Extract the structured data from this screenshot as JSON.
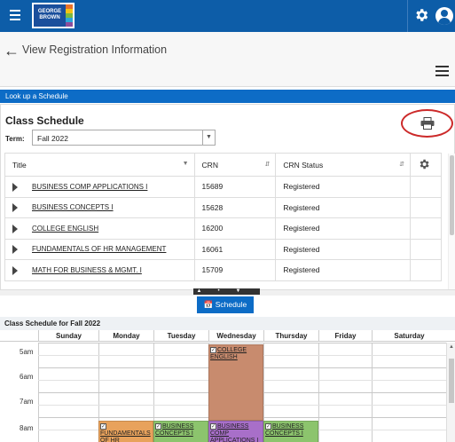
{
  "topbar": {
    "logo_text": "GEORGE BROWN",
    "logo_stripe_colors": [
      "#e9722a",
      "#f3c216",
      "#7bb841",
      "#2ba6d9",
      "#8a4d9c"
    ],
    "settings_icon": "gear-icon",
    "user_icon": "user-icon"
  },
  "header": {
    "back_icon": "arrow-left-icon",
    "title": "View Registration Information",
    "menu_icon": "hamburger-icon"
  },
  "lookup": {
    "label": "Look up a Schedule"
  },
  "class_schedule": {
    "title": "Class Schedule",
    "print_icon": "printer-icon",
    "term_label": "Term:",
    "term_value": "Fall 2022",
    "columns": [
      "Title",
      "CRN",
      "CRN Status"
    ],
    "rows": [
      {
        "title": "BUSINESS COMP APPLICATIONS I",
        "crn": "15689",
        "status": "Registered"
      },
      {
        "title": "BUSINESS CONCEPTS I",
        "crn": "15628",
        "status": "Registered"
      },
      {
        "title": "COLLEGE ENGLISH",
        "crn": "16200",
        "status": "Registered"
      },
      {
        "title": "FUNDAMENTALS OF HR MANAGEMENT",
        "crn": "16061",
        "status": "Registered"
      },
      {
        "title": "MATH FOR BUSINESS & MGMT. I",
        "crn": "15709",
        "status": "Registered"
      }
    ]
  },
  "schedule_button": {
    "label": "Schedule",
    "icon": "calendar-icon"
  },
  "calendar": {
    "title": "Class Schedule for Fall 2022",
    "days": [
      "Sunday",
      "Monday",
      "Tuesday",
      "Wednesday",
      "Thursday",
      "Friday",
      "Saturday"
    ],
    "times": [
      "5am",
      "6am",
      "7am",
      "8am"
    ],
    "events": [
      {
        "label": "COLLEGE ENGLISH",
        "day": "Wednesday",
        "color": "#c88b6e"
      },
      {
        "label": "FUNDAMENTALS OF HR MANAGEMENT",
        "day": "Monday",
        "color": "#e8a25c"
      },
      {
        "label": "BUSINESS CONCEPTS I",
        "day": "Tuesday",
        "color": "#8cc46d"
      },
      {
        "label": "BUSINESS COMP APPLICATIONS I",
        "day": "Wednesday",
        "color": "#a86fc9"
      },
      {
        "label": "BUSINESS CONCEPTS I",
        "day": "Thursday",
        "color": "#8cc46d"
      }
    ]
  },
  "colors": {
    "brand_blue": "#0d5da8",
    "accent_blue": "#0d6cc6",
    "highlight_red": "#cc2a2a"
  }
}
